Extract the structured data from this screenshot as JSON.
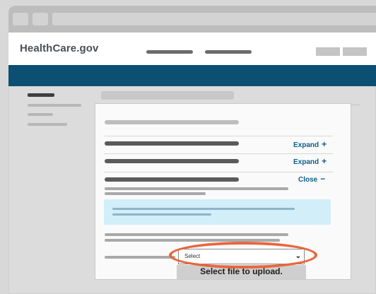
{
  "site": {
    "logo_text": "HealthCare.gov"
  },
  "form": {
    "rows": [
      {
        "action_label": "Expand",
        "action_symbol": "+"
      },
      {
        "action_label": "Expand",
        "action_symbol": "+"
      },
      {
        "action_label": "Close",
        "action_symbol": "−"
      }
    ],
    "select": {
      "selected": "Select"
    },
    "upload_button_label": "Select file to upload."
  },
  "colors": {
    "brand_navy": "#0b4f73",
    "link_blue": "#0b5f8a",
    "highlight": "#e8663d",
    "callout_bg": "#d2eef9"
  },
  "icons": {
    "expand": "plus-icon",
    "close": "minus-icon",
    "dropdown": "chevron-down-icon"
  }
}
